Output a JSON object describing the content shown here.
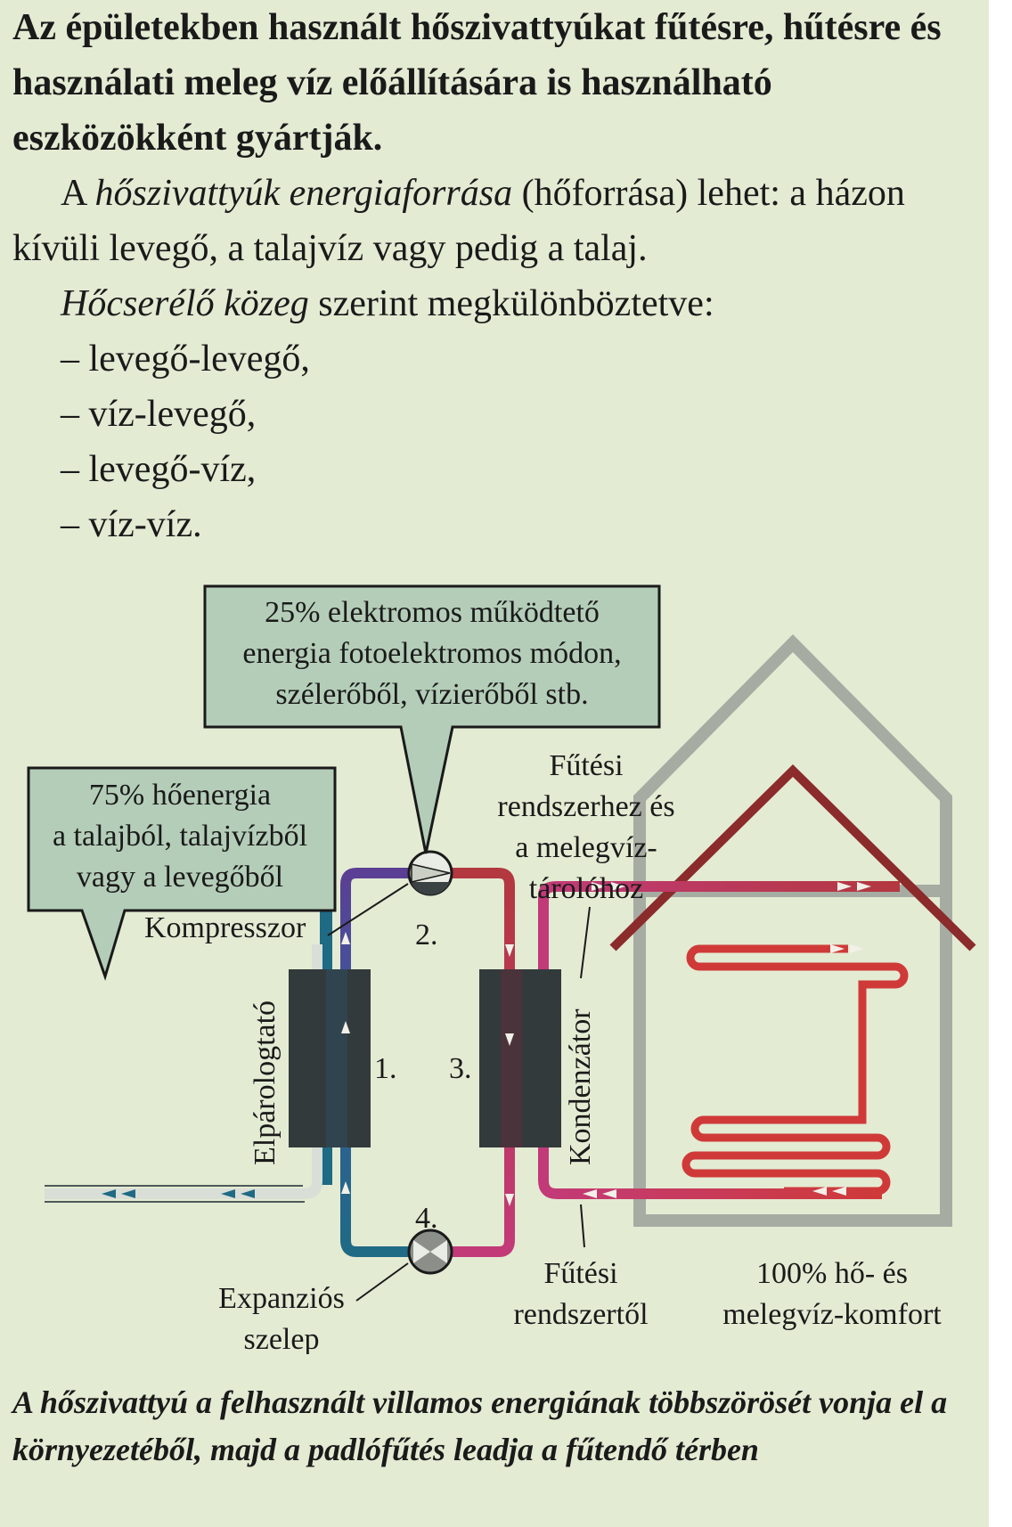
{
  "intro": "Az épületekben használt hőszivattyúkat fűtésre, hűtésre és használati meleg víz előállítására is használható eszközökként gyártják.",
  "para1": {
    "prefix": "A ",
    "emphasis": "hőszivattyúk energiaforrása",
    "suffix": " (hőforrása) lehet: a házon kívüli levegő, a talajvíz vagy pedig a talaj."
  },
  "para2": {
    "emphasis": "Hőcserélő közeg",
    "suffix": " szerint megkülönböztetve:"
  },
  "list": [
    "– levegő-levegő,",
    "– víz-levegő,",
    "– levegő-víz,",
    "– víz-víz."
  ],
  "diagram": {
    "callout_electric": [
      "25% elektromos működtető",
      "energia fotoelektromos módon,",
      "szélerőből, vízierőből stb."
    ],
    "callout_heat": [
      "75% hőenergia",
      "a talajból, talajvízből",
      "vagy a levegőből"
    ],
    "label_compressor": "Kompresszor",
    "label_evaporator": "Elpárologtató",
    "label_condenser": "Kondenzátor",
    "label_expansion": [
      "Expanziós",
      "szelep"
    ],
    "label_to_heating": [
      "Fűtési",
      "rendszerhez és",
      "a melegvíz-",
      "tárolóhoz"
    ],
    "label_from_heating": [
      "Fűtési",
      "rendszertől"
    ],
    "label_comfort": [
      "100% hő- és",
      "melegvíz-komfort"
    ],
    "step_labels": [
      "1.",
      "2.",
      "3.",
      "4."
    ],
    "colors": {
      "ground_loop": "#1f6a85",
      "refrigerant_cold": "#2d6d98",
      "refrigerant_mid": "#5b3f94",
      "refrigerant_hot": "#b3383f",
      "heating_loop": "#c23a78",
      "floor_coil": "#cf3a38",
      "house": "#a6aca2",
      "roof": "#8b2b2b",
      "callout_fill": "#b4cdb8",
      "exchanger": "#333a3c"
    }
  },
  "caption": "A hőszivattyú a felhasznált villamos energiának többszörösét vonja el a környezetéből, majd a padlófűtés leadja a fűtendő térben"
}
